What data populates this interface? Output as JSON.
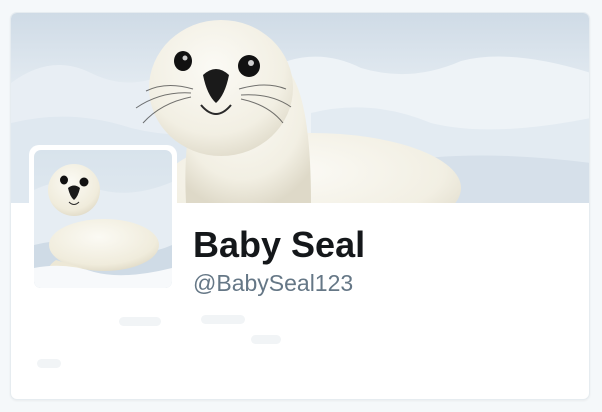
{
  "profile": {
    "display_name": "Baby Seal",
    "screen_name": "@BabySeal123"
  },
  "images": {
    "banner": "seal-on-ice-banner",
    "avatar": "seal-on-ice-avatar"
  },
  "colors": {
    "name": "#14171a",
    "handle": "#657786",
    "card_background": "#ffffff",
    "page_background": "#f5f8fa"
  }
}
